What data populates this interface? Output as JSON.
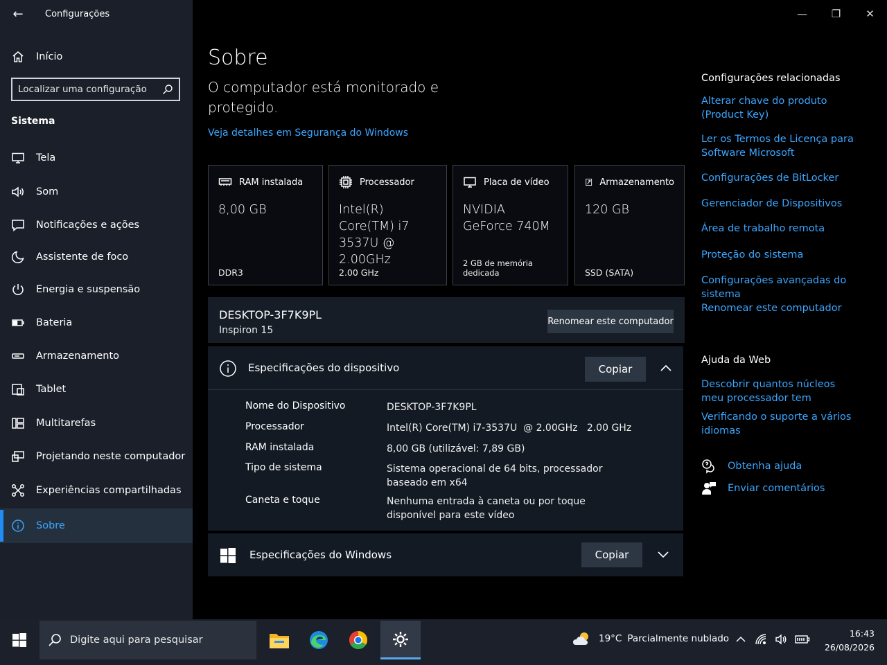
{
  "window": {
    "title": "Configurações",
    "back_glyph": "←",
    "minimize_glyph": "—",
    "restore_glyph": "❐",
    "close_glyph": "✕"
  },
  "sidebar": {
    "home_label": "Início",
    "search_placeholder": "Localizar uma configuração",
    "section_label": "Sistema",
    "items": [
      {
        "label": "Tela",
        "icon": "monitor-icon"
      },
      {
        "label": "Som",
        "icon": "speaker-icon"
      },
      {
        "label": "Notificações e ações",
        "icon": "notification-icon"
      },
      {
        "label": "Assistente de foco",
        "icon": "moon-icon"
      },
      {
        "label": "Energia e suspensão",
        "icon": "power-icon"
      },
      {
        "label": "Bateria",
        "icon": "battery-icon"
      },
      {
        "label": "Armazenamento",
        "icon": "storage-icon"
      },
      {
        "label": "Tablet",
        "icon": "tablet-icon"
      },
      {
        "label": "Multitarefas",
        "icon": "multitask-icon"
      },
      {
        "label": "Projetando neste computador",
        "icon": "project-icon"
      },
      {
        "label": "Experiências compartilhadas",
        "icon": "share-icon"
      },
      {
        "label": "Sobre",
        "icon": "info-icon",
        "active": true
      }
    ]
  },
  "main": {
    "title": "Sobre",
    "subtitle": "O computador está monitorado e protegido.",
    "security_link": "Veja detalhes em Segurança do Windows",
    "cards": [
      {
        "label": "RAM instalada",
        "value": "8,00 GB",
        "sub": "DDR3",
        "icon": "ram-icon"
      },
      {
        "label": "Processador",
        "value": "Intel(R) Core(TM) i7 3537U @ 2.00GHz",
        "sub": "2.00 GHz",
        "icon": "cpu-icon"
      },
      {
        "label": "Placa de vídeo",
        "value": "NVIDIA GeForce 740M",
        "sub": "2 GB de memória dedicada",
        "icon": "gpu-icon"
      },
      {
        "label": "Armazenamento",
        "value": "120 GB",
        "sub": "SSD (SATA)",
        "icon": "disk-icon"
      }
    ],
    "pc": {
      "name": "DESKTOP-3F7K9PL",
      "model": "Inspiron 15",
      "rename_label": "Renomear este computador"
    },
    "device_specs": {
      "title": "Especificações do dispositivo",
      "copy_label": "Copiar",
      "rows": [
        {
          "label": "Nome do Dispositivo",
          "value": "DESKTOP-3F7K9PL"
        },
        {
          "label": "Processador",
          "value": "Intel(R) Core(TM) i7-3537U  @ 2.00GHz   2.00 GHz"
        },
        {
          "label": "RAM instalada",
          "value": "8,00 GB (utilizável: 7,89 GB)"
        },
        {
          "label": "Tipo de sistema",
          "value": "Sistema operacional de 64 bits, processador baseado em x64"
        },
        {
          "label": "Caneta e toque",
          "value": "Nenhuma entrada à caneta ou por toque disponível para este vídeo"
        }
      ]
    },
    "windows_specs": {
      "title": "Especificações do Windows",
      "copy_label": "Copiar"
    }
  },
  "related": {
    "heading": "Configurações relacionadas",
    "links": [
      "Alterar chave do produto (Product Key)",
      "Ler os Termos de Licença para Software Microsoft",
      "Configurações de BitLocker",
      "Gerenciador de Dispositivos",
      "Área de trabalho remota",
      "Proteção do sistema",
      "Configurações avançadas do sistema",
      "Renomear este computador"
    ],
    "web_heading": "Ajuda da Web",
    "web_links": [
      "Descobrir quantos núcleos meu processador tem",
      "Verificando o suporte a vários idiomas"
    ],
    "help_label": "Obtenha ajuda",
    "feedback_label": "Enviar comentários"
  },
  "taskbar": {
    "search_placeholder": "Digite aqui para pesquisar",
    "weather_temp": "19°C",
    "weather_desc": "Parcialmente nublado",
    "time": "16:43",
    "date": "26/08/2026",
    "apps": [
      "file-explorer-icon",
      "edge-icon",
      "chrome-icon",
      "settings-icon"
    ]
  },
  "colors": {
    "accent": "#3aa6ff",
    "sidebar_bg": "#1a1f2a",
    "taskbar_bg": "#1b202b"
  }
}
